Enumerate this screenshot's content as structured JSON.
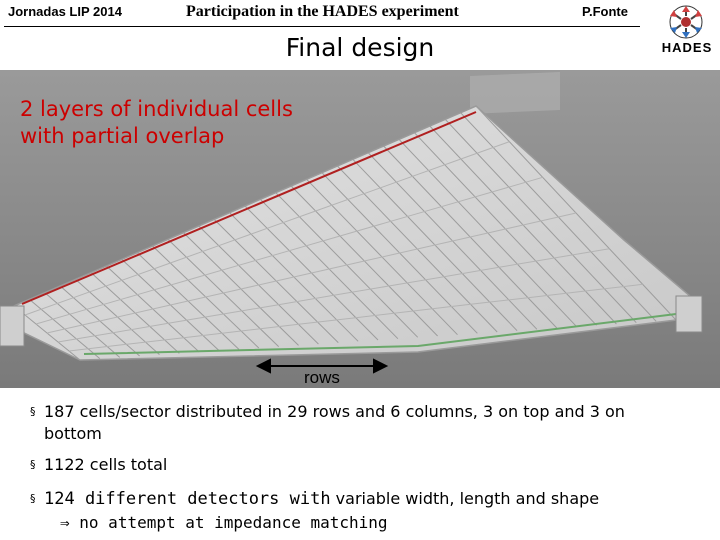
{
  "header": {
    "left": "Jornadas LIP 2014",
    "center": "Participation in the HADES experiment",
    "right": "P.Fonte",
    "logo_text": "HADES"
  },
  "title": "Final design",
  "figure": {
    "overlay_line1": "2 layers of individual cells",
    "overlay_line2": "with partial overlap",
    "rows_label": "rows"
  },
  "bullets": {
    "b1_line1": "187 cells/sector distributed in 29 rows and 6 columns, 3 on top and 3 on",
    "b1_line2": "bottom",
    "b2": "1122 cells total",
    "b3_mono": "124 different detectors with",
    "b3_rest": " variable width, length and shape",
    "b3_sub": "no attempt at impedance matching",
    "arrow_glyph": "⇒",
    "bullet_glyph": "§"
  },
  "colors": {
    "overlay_text": "#cc0000",
    "figure_background": "#8e8e8e"
  }
}
